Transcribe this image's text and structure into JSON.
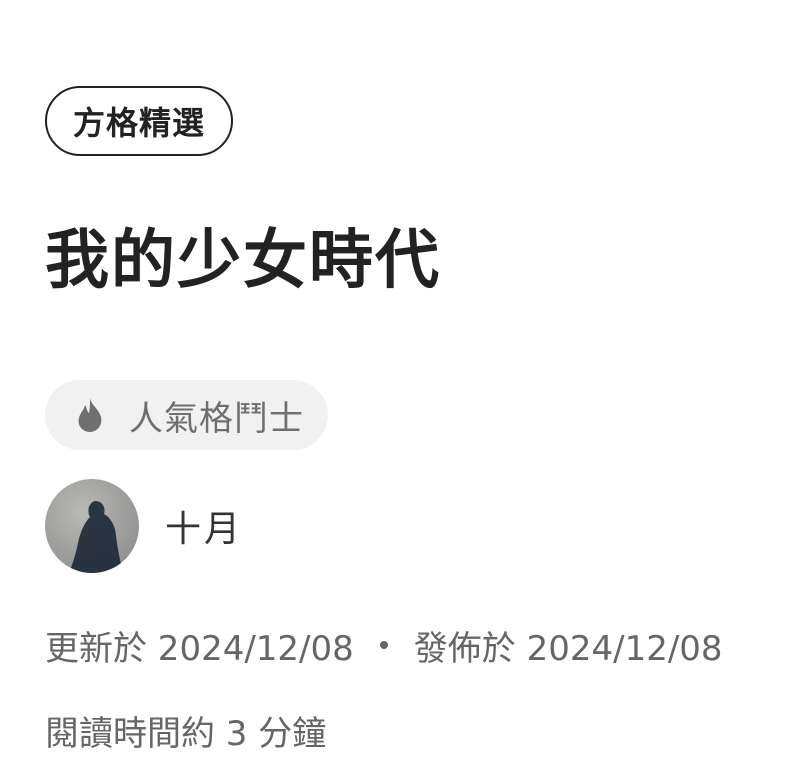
{
  "badge": {
    "label": "方格精選"
  },
  "article": {
    "title": "我的少女時代"
  },
  "fighter_badge": {
    "icon": "flame-icon",
    "label": "人氣格鬥士"
  },
  "author": {
    "name": "十月"
  },
  "meta": {
    "updated": "更新於 2024/12/08",
    "separator": "•",
    "published": "發佈於 2024/12/08",
    "reading_time": "閱讀時間約 3 分鐘"
  }
}
